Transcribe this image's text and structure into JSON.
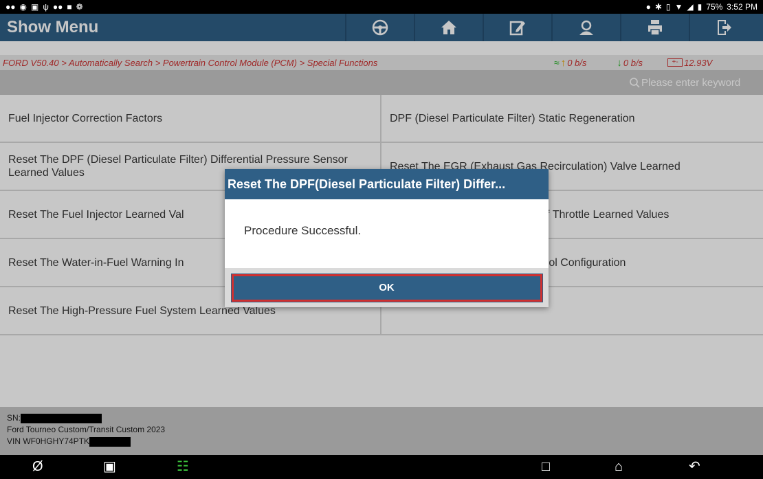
{
  "status_bar": {
    "battery_percent": "75%",
    "time": "3:52 PM"
  },
  "header": {
    "title": "Show Menu"
  },
  "toolbar": {
    "buttons": [
      {
        "icon": "steering-wheel-icon"
      },
      {
        "icon": "home-icon"
      },
      {
        "icon": "edit-report-icon"
      },
      {
        "icon": "user-icon"
      },
      {
        "icon": "print-icon"
      },
      {
        "icon": "exit-icon"
      }
    ]
  },
  "breadcrumb": {
    "path": "FORD V50.40 > Automatically Search > Powertrain Control Module (PCM) > Special Functions",
    "upload_rate": "0 b/s",
    "download_rate": "0 b/s",
    "voltage": "12.93V"
  },
  "search": {
    "placeholder": "Please enter keyword"
  },
  "menu": {
    "rows": [
      {
        "left": "Fuel Injector Correction Factors",
        "right": "DPF (Diesel Particulate Filter) Static Regeneration"
      },
      {
        "left": "Reset The DPF (Diesel Particulate Filter) Differential Pressure Sensor Learned Values",
        "right": "Reset The EGR (Exhaust Gas Recirculation) Valve Learned"
      },
      {
        "left": "Reset The Fuel Injector Learned Val",
        "right": "ff Throttle Learned Values"
      },
      {
        "left": "Reset The Water-in-Fuel Warning In",
        "right": "rol Configuration"
      },
      {
        "left": "Reset The High-Pressure Fuel System Learned Values",
        "right": ""
      }
    ]
  },
  "footer": {
    "sn_label": "SN:",
    "vehicle": "Ford Tourneo Custom/Transit Custom 2023",
    "vin_label": "VIN WF0HGHY74PTK"
  },
  "dialog": {
    "title": "Reset The DPF(Diesel Particulate Filter) Differ...",
    "message": "Procedure Successful.",
    "ok_label": "OK"
  },
  "colors": {
    "header_blue": "#2f5f86",
    "breadcrumb_red": "#cc3232",
    "ok_border_red": "#d03030"
  }
}
